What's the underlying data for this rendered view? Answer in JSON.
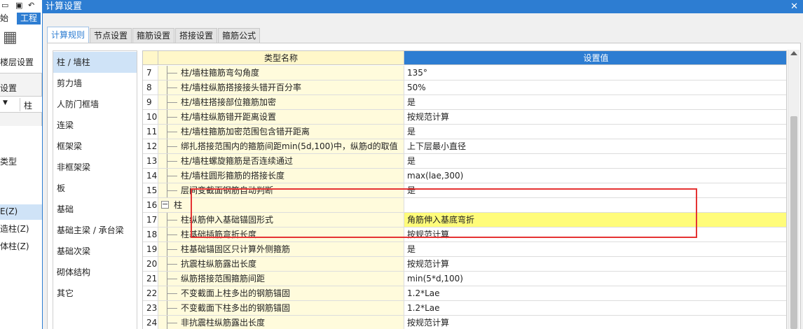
{
  "background_app": {
    "ribbon_tab_home": "始",
    "ribbon_tab_active": "工程",
    "floor_settings": "楼层设置",
    "settings": "设置",
    "combo_value": "柱",
    "type_label": "类型",
    "list_items": [
      "E(Z)",
      "造柱(Z)",
      "体柱(Z)"
    ]
  },
  "dialog": {
    "title": "计算设置",
    "close_label": "✕"
  },
  "tabs": [
    {
      "label": "计算规则",
      "active": true
    },
    {
      "label": "节点设置",
      "active": false
    },
    {
      "label": "箍筋设置",
      "active": false
    },
    {
      "label": "搭接设置",
      "active": false
    },
    {
      "label": "箍筋公式",
      "active": false
    }
  ],
  "categories": [
    {
      "label": "柱 / 墙柱",
      "active": true
    },
    {
      "label": "剪力墙",
      "active": false
    },
    {
      "label": "人防门框墙",
      "active": false
    },
    {
      "label": "连梁",
      "active": false
    },
    {
      "label": "框架梁",
      "active": false
    },
    {
      "label": "非框架梁",
      "active": false
    },
    {
      "label": "板",
      "active": false
    },
    {
      "label": "基础",
      "active": false
    },
    {
      "label": "基础主梁 / 承台梁",
      "active": false
    },
    {
      "label": "基础次梁",
      "active": false
    },
    {
      "label": "砌体结构",
      "active": false
    },
    {
      "label": "其它",
      "active": false
    }
  ],
  "grid": {
    "header_name": "类型名称",
    "header_value": "设置值",
    "rows": [
      {
        "num": "7",
        "name": "柱/墙柱箍筋弯勾角度",
        "value": "135°"
      },
      {
        "num": "8",
        "name": "柱/墙柱纵筋搭接接头错开百分率",
        "value": "50%"
      },
      {
        "num": "9",
        "name": "柱/墙柱搭接部位箍筋加密",
        "value": "是"
      },
      {
        "num": "10",
        "name": "柱/墙柱纵筋错开距离设置",
        "value": "按规范计算"
      },
      {
        "num": "11",
        "name": "柱/墙柱箍筋加密范围包含错开距离",
        "value": "是"
      },
      {
        "num": "12",
        "name": "绑扎搭接范围内的箍筋间距min(5d,100)中，纵筋d的取值",
        "value": "上下层最小直径"
      },
      {
        "num": "13",
        "name": "柱/墙柱螺旋箍筋是否连续通过",
        "value": "是"
      },
      {
        "num": "14",
        "name": "柱/墙柱圆形箍筋的搭接长度",
        "value": "max(lae,300)"
      },
      {
        "num": "15",
        "name": "层间变截面钢筋自动判断",
        "value": "是"
      },
      {
        "num": "16",
        "name": "柱",
        "value": "",
        "group": true
      },
      {
        "num": "17",
        "name": "柱纵筋伸入基础锚固形式",
        "value": "角筋伸入基底弯折",
        "selected": true
      },
      {
        "num": "18",
        "name": "柱基础插筋弯折长度",
        "value": "按规范计算"
      },
      {
        "num": "19",
        "name": "柱基础锚固区只计算外侧箍筋",
        "value": "是"
      },
      {
        "num": "20",
        "name": "抗震柱纵筋露出长度",
        "value": "按规范计算"
      },
      {
        "num": "21",
        "name": "纵筋搭接范围箍筋间距",
        "value": "min(5*d,100)"
      },
      {
        "num": "22",
        "name": "不变截面上柱多出的钢筋锚固",
        "value": "1.2*Lae"
      },
      {
        "num": "23",
        "name": "不变截面下柱多出的钢筋锚固",
        "value": "1.2*Lae"
      },
      {
        "num": "24",
        "name": "非抗震柱纵筋露出长度",
        "value": "按规范计算"
      }
    ]
  },
  "expander_symbol": "−",
  "colors": {
    "accent": "#2d7dd2",
    "highlight_border": "#e53333",
    "selected_value_bg": "#fffc7a",
    "name_cell_bg": "#fffbdc"
  }
}
